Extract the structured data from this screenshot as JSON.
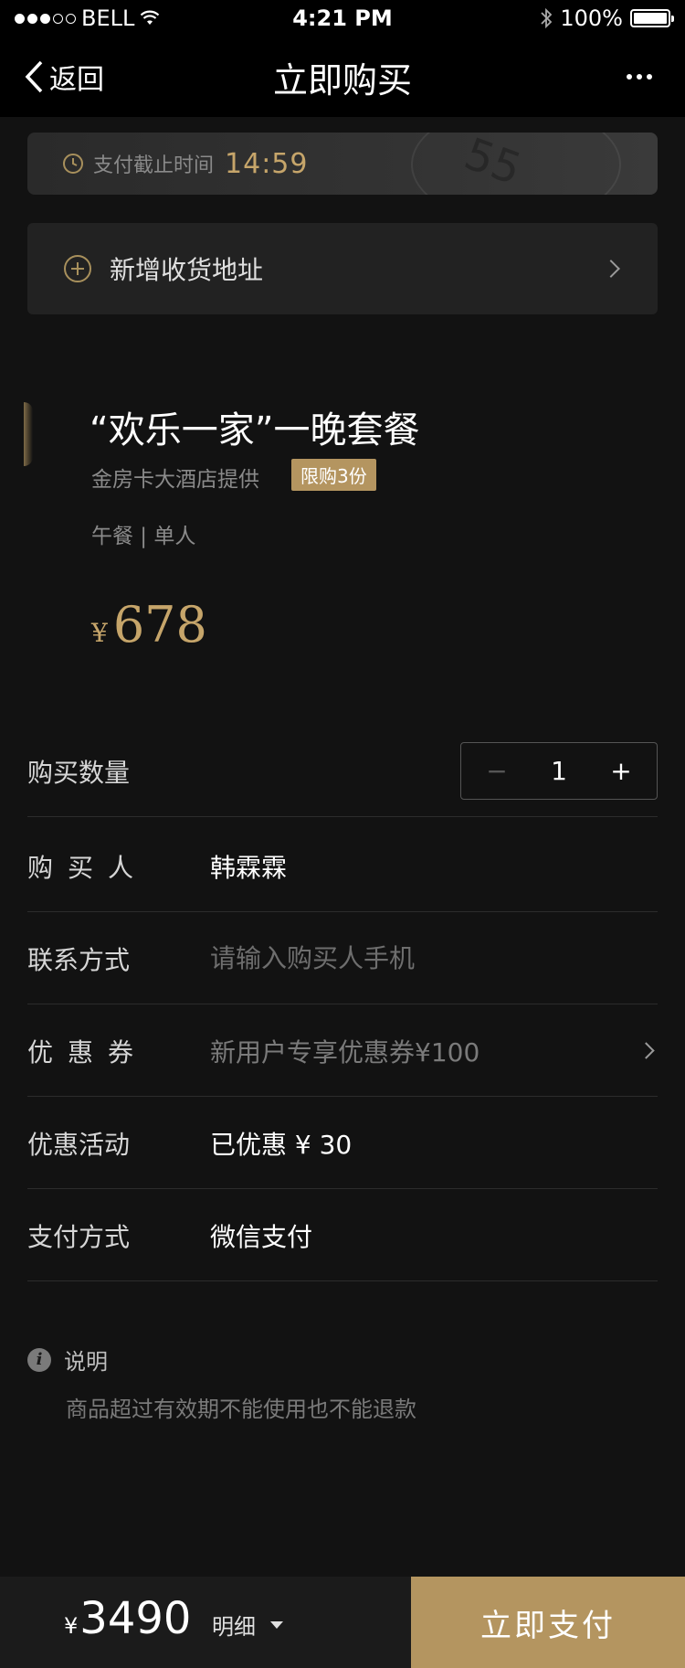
{
  "status_bar": {
    "carrier": "BELL",
    "time": "4:21 PM",
    "battery": "100%",
    "battery_level": 1.0
  },
  "nav": {
    "back_label": "返回",
    "title": "立即购买"
  },
  "countdown": {
    "label": "支付截止时间",
    "time": "14:59",
    "bg_text": "55"
  },
  "address": {
    "label": "新增收货地址"
  },
  "product": {
    "title": "“欢乐一家”一晚套餐",
    "provider": "金房卡大酒店提供",
    "limit_badge": "限购3份",
    "meta": "午餐 | 单人",
    "price_currency": "¥",
    "price": "678"
  },
  "form": {
    "quantity": {
      "label": "购买数量",
      "value": "1",
      "minus": "−",
      "plus": "+"
    },
    "buyer": {
      "label": "购买人",
      "value": "韩霖霖"
    },
    "contact": {
      "label": "联系方式",
      "placeholder": "请输入购买人手机"
    },
    "coupon": {
      "label": "优惠券",
      "value": "新用户专享优惠券¥100"
    },
    "promotion": {
      "label": "优惠活动",
      "value": "已优惠 ¥ 30"
    },
    "payment": {
      "label": "支付方式",
      "value": "微信支付"
    }
  },
  "notes": {
    "title": "说明",
    "text": "商品超过有效期不能使用也不能退款"
  },
  "bottom": {
    "currency": "¥",
    "total": "3490",
    "detail_label": "明细",
    "pay_label": "立即支付"
  },
  "colors": {
    "accent": "#c6a56a",
    "button": "#b49560",
    "background": "#121212"
  }
}
